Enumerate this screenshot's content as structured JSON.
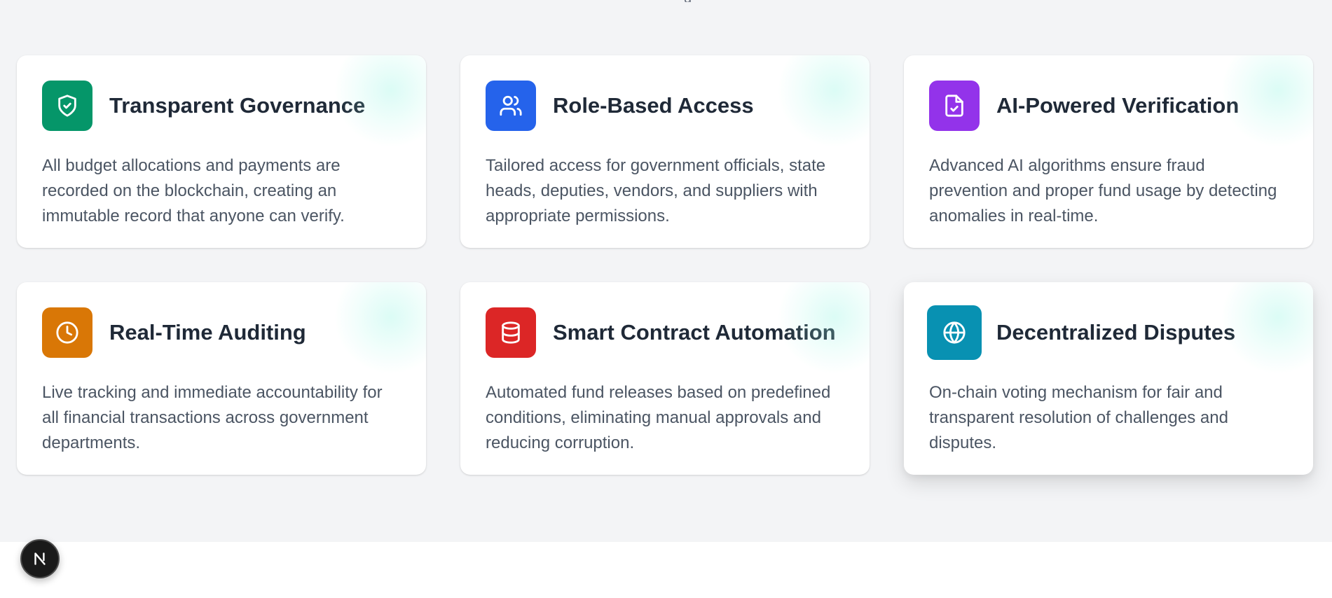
{
  "top_fragment": "g",
  "features": [
    {
      "title": "Transparent Governance",
      "description": "All budget allocations and payments are recorded on the blockchain, creating an immutable record that anyone can verify.",
      "icon": "shield-check-icon",
      "color": "#059669"
    },
    {
      "title": "Role-Based Access",
      "description": "Tailored access for government officials, state heads, deputies, vendors, and suppliers with appropriate permissions.",
      "icon": "users-icon",
      "color": "#2563eb"
    },
    {
      "title": "AI-Powered Verification",
      "description": "Advanced AI algorithms ensure fraud prevention and proper fund usage by detecting anomalies in real-time.",
      "icon": "file-check-icon",
      "color": "#9333ea"
    },
    {
      "title": "Real-Time Auditing",
      "description": "Live tracking and immediate accountability for all financial transactions across government departments.",
      "icon": "clock-icon",
      "color": "#d97706"
    },
    {
      "title": "Smart Contract Automation",
      "description": "Automated fund releases based on predefined conditions, eliminating manual approvals and reducing corruption.",
      "icon": "database-icon",
      "color": "#dc2626"
    },
    {
      "title": "Decentralized Disputes",
      "description": "On-chain voting mechanism for fair and transparent resolution of challenges and disputes.",
      "icon": "globe-icon",
      "color": "#0891b2"
    }
  ],
  "dev_badge": {
    "icon": "nextjs-logo-icon"
  }
}
